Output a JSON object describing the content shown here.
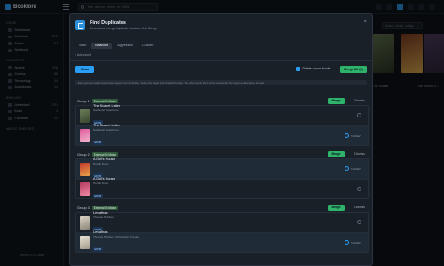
{
  "app": {
    "brand": "Booklore"
  },
  "topbar": {
    "search_placeholder": "Title, author, series, or ISBN"
  },
  "sidebar": {
    "sections": [
      {
        "title": "HOME",
        "items": [
          {
            "label": "Dashboard",
            "count": ""
          },
          {
            "label": "All Books",
            "count": "272"
          },
          {
            "label": "Series",
            "count": "97"
          },
          {
            "label": "Notebook",
            "count": ""
          }
        ]
      },
      {
        "title": "LIBRARIES",
        "items": [
          {
            "label": "Novels",
            "count": "128"
          },
          {
            "label": "Comics",
            "count": "86"
          },
          {
            "label": "Technology",
            "count": "34"
          },
          {
            "label": "Audiobooks",
            "count": "24"
          }
        ]
      },
      {
        "title": "SHELVES",
        "items": [
          {
            "label": "Unshelved",
            "count": "231"
          },
          {
            "label": "Kobo",
            "count": "4"
          },
          {
            "label": "Favorites",
            "count": "12"
          }
        ]
      },
      {
        "title": "MAGIC SHELVES",
        "items": []
      }
    ],
    "version": "Version 1.0.0-beta"
  },
  "background": {
    "filter_placeholder": "Search, series, or tags",
    "book_labels": [
      "The Scarlet",
      "The Shroud O..."
    ]
  },
  "modal": {
    "title": "Find Duplicates",
    "subtitle": "Detect and merge duplicate books in this library",
    "tabs": [
      "Strict",
      "Balanced",
      "Aggressive",
      "Custom"
    ],
    "active_tab": "Balanced",
    "advanced_label": "› Advanced",
    "scan_label": "Scan",
    "delete_label": "Delete source books",
    "merge_all_label": "Merge All (3)",
    "info_text": "Each group contains books that appear to be duplicates. Select the target book that will be kept. The other books' files will be attached to the target as alternative formats.",
    "merge_label": "Merge",
    "dismiss_label": "Dismiss",
    "target_label": "TARGET",
    "groups": [
      {
        "label": "Group 1",
        "badge": "External ID Match",
        "books": [
          {
            "title": "The Scarlet Letter",
            "author": "Nathaniel Hawthorne",
            "format": "EPUB",
            "target": false
          },
          {
            "title": "The Scarlet Letter",
            "author": "Nathaniel Hawthorne",
            "format": "EPUB",
            "target": true
          }
        ]
      },
      {
        "label": "Group 2",
        "badge": "External ID Match",
        "books": [
          {
            "title": "A Doll's House",
            "author": "Henrik Ibsen",
            "format": "EPUB",
            "target": true
          },
          {
            "title": "A Doll's House",
            "author": "Henrik Ibsen",
            "format": "EPUB",
            "target": false
          }
        ]
      },
      {
        "label": "Group 3",
        "badge": "External ID Match",
        "books": [
          {
            "title": "Leviathan",
            "author": "Thomas Hobbes",
            "format": "EPUB",
            "target": false
          },
          {
            "title": "Leviathan",
            "author": "Thomas Hobbes, Christopher Brooke",
            "format": "EPUB",
            "target": true
          }
        ]
      }
    ]
  },
  "colors": {
    "accent": "#2a9df4",
    "merge": "#2fb36b",
    "background": "#0d1117",
    "panel": "#1a2028"
  }
}
